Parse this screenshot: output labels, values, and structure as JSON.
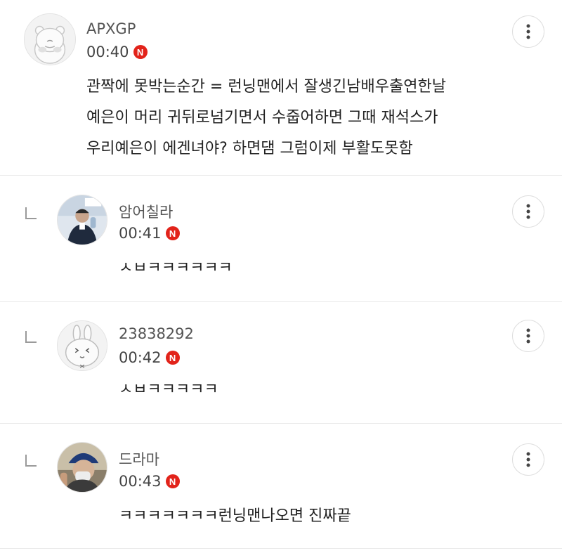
{
  "comments": [
    {
      "author": "APXGP",
      "time": "00:40",
      "badge": "N",
      "lines": [
        "관짝에 못박는순간 = 런닝맨에서 잘생긴남배우출연한날",
        "예은이 머리 귀뒤로넘기면서 수줍어하면 그때 재석스가",
        "우리예은이 에겐녀야? 하면댐 그럼이제 부활도못함"
      ]
    },
    {
      "author": "암어칠라",
      "time": "00:41",
      "badge": "N",
      "text": "ㅅㅂㅋㅋㅋㅋㅋㅋ"
    },
    {
      "author": "23838292",
      "time": "00:42",
      "badge": "N",
      "text": "ㅅㅂㅋㅋㅋㅋㅋ"
    },
    {
      "author": "드라마",
      "time": "00:43",
      "badge": "N",
      "text": "ㅋㅋㅋㅋㅋㅋㅋ런닝맨나오면 진짜끝"
    }
  ],
  "icons": {
    "more": "vertical-ellipsis-icon",
    "reply": "reply-arrow-icon",
    "badge_color": "#e2231a"
  }
}
